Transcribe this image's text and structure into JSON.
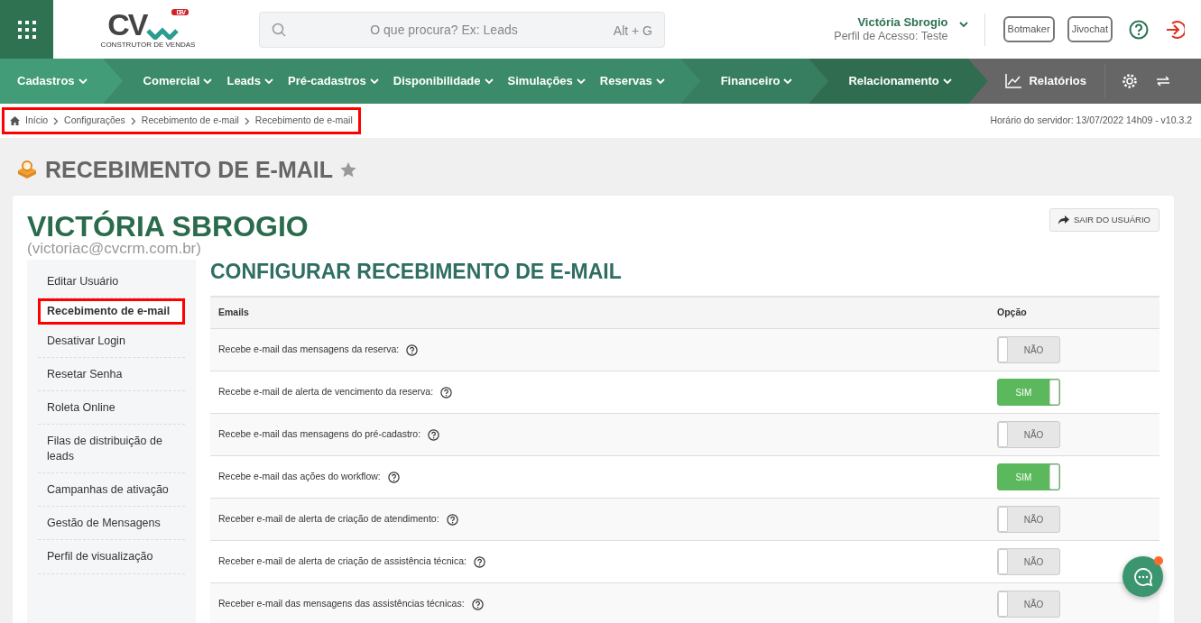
{
  "header": {
    "logo_text": "CV",
    "logo_badge": "DEV",
    "logo_tagline": "CONSTRUTOR DE VENDAS",
    "search": {
      "placeholder": "O que procura? Ex: Leads",
      "shortcut": "Alt + G"
    },
    "user": {
      "name": "Victória Sbrogio",
      "profile": "Perfil de Acesso: Teste"
    },
    "buttons": [
      "Botmaker",
      "Jivochat"
    ]
  },
  "nav_groups": [
    {
      "color": "#419c77",
      "items": [
        "Cadastros"
      ]
    },
    {
      "color": "#3b8a69",
      "items": [
        "Comercial",
        "Leads",
        "Pré-cadastros",
        "Disponibilidade",
        "Simulações",
        "Reservas"
      ]
    },
    {
      "color": "#367e5f",
      "items": [
        "Financeiro"
      ]
    },
    {
      "color": "#2f6c50",
      "items": [
        "Relacionamento"
      ]
    }
  ],
  "reports": "Relatórios",
  "breadcrumb": {
    "highlighted": true,
    "items": [
      "Início",
      "Configurações",
      "Recebimento de e-mail",
      "Recebimento de e-mail"
    ]
  },
  "server_time": "Horário do servidor: 13/07/2022 14h09 - v10.3.2",
  "page_title": "RECEBIMENTO DE E-MAIL",
  "user_name": "VICTÓRIA SBROGIO",
  "user_email": "(victoriac@cvcrm.com.br)",
  "logout_button": "SAIR DO USUÁRIO",
  "sidebar": {
    "items": [
      {
        "label": "Editar Usuário",
        "selected": false,
        "highlighted": false
      },
      {
        "label": "Recebimento de e-mail",
        "selected": true,
        "highlighted": true
      },
      {
        "label": "Desativar Login",
        "selected": false,
        "highlighted": false
      },
      {
        "label": "Resetar Senha",
        "selected": false,
        "highlighted": false
      },
      {
        "label": "Roleta Online",
        "selected": false,
        "highlighted": false
      },
      {
        "label": "Filas de distribuição de leads",
        "selected": false,
        "highlighted": false
      },
      {
        "label": "Campanhas de ativação",
        "selected": false,
        "highlighted": false
      },
      {
        "label": "Gestão de Mensagens",
        "selected": false,
        "highlighted": false
      },
      {
        "label": "Perfil de visualização",
        "selected": false,
        "highlighted": false
      }
    ]
  },
  "section_title": "CONFIGURAR RECEBIMENTO DE E-MAIL",
  "table": {
    "columns": [
      "Emails",
      "Opção"
    ],
    "rows": [
      {
        "label": "Recebe e-mail das mensagens da reserva:",
        "on": false,
        "toggle": "NÃO"
      },
      {
        "label": "Recebe e-mail de alerta de vencimento da reserva:",
        "on": true,
        "toggle": "SIM"
      },
      {
        "label": "Recebe e-mail das mensagens do pré-cadastro:",
        "on": false,
        "toggle": "NÃO"
      },
      {
        "label": "Recebe e-mail das ações do workflow:",
        "on": true,
        "toggle": "SIM"
      },
      {
        "label": "Receber e-mail de alerta de criação de atendimento:",
        "on": false,
        "toggle": "NÃO"
      },
      {
        "label": "Receber e-mail de alerta de criação de assistência técnica:",
        "on": false,
        "toggle": "NÃO"
      },
      {
        "label": "Receber e-mail das mensagens das assistências técnicas:",
        "on": false,
        "toggle": "NÃO"
      }
    ]
  },
  "chat": {
    "unread": true
  }
}
